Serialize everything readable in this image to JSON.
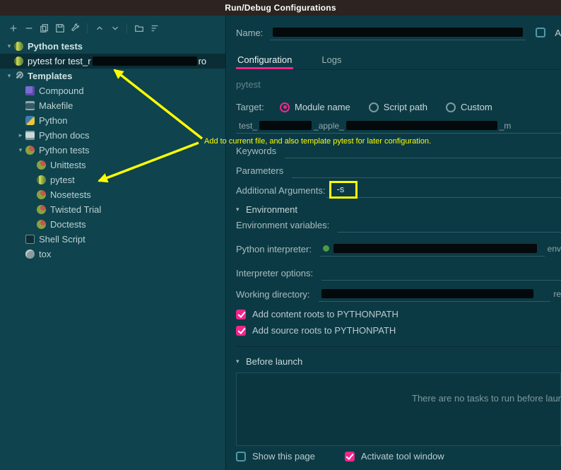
{
  "titlebar": {
    "title": "Run/Debug Configurations"
  },
  "icons": {
    "chevron_down": "▾",
    "chevron_right": "▸"
  },
  "toolbar": {
    "buttons": [
      "add",
      "remove",
      "copy",
      "save",
      "edit-templates",
      "move-up",
      "move-down",
      "new-folder",
      "sort"
    ]
  },
  "tree": {
    "items": [
      {
        "label": "Python tests"
      },
      {
        "label": "pytest for test_r",
        "suffix": "ro"
      },
      {
        "label": "Templates"
      },
      {
        "label": "Compound"
      },
      {
        "label": "Makefile"
      },
      {
        "label": "Python"
      },
      {
        "label": "Python docs"
      },
      {
        "label": "Python tests"
      },
      {
        "label": "Unittests"
      },
      {
        "label": "pytest"
      },
      {
        "label": "Nosetests"
      },
      {
        "label": "Twisted Trial"
      },
      {
        "label": "Doctests"
      },
      {
        "label": "Shell Script"
      },
      {
        "label": "tox"
      }
    ]
  },
  "form": {
    "name_label": "Name:",
    "allow_parallel_fragment": "A",
    "tabs": {
      "configuration": "Configuration",
      "logs": "Logs"
    },
    "group_label": "pytest",
    "target": {
      "label": "Target:",
      "options": {
        "module": "Module name",
        "script": "Script path",
        "custom": "Custom"
      },
      "selected": "Module name",
      "field_fragments": {
        "start": "test_",
        "mid": "_apple_",
        "end": "_m"
      }
    },
    "keywords_label": "Keywords",
    "parameters_label": "Parameters",
    "additional_arguments": {
      "label": "Additional Arguments:",
      "value": "-s"
    },
    "environment": {
      "section": "Environment",
      "env_vars_label": "Environment variables:",
      "interpreter_label": "Python interpreter:",
      "interpreter_edge_fragment": "env",
      "options_label": "Interpreter options:",
      "workdir_label": "Working directory:",
      "workdir_edge_fragment": "re",
      "add_content_roots": "Add content roots to PYTHONPATH",
      "add_source_roots": "Add source roots to PYTHONPATH"
    },
    "before_launch": {
      "section": "Before launch",
      "empty_text": "There are no tasks to run before launch"
    },
    "bottom": {
      "show_this": "Show this page",
      "activate": "Activate tool window"
    }
  },
  "annotation": {
    "text": "Add to current file, and also template pytest for later configuration."
  },
  "colors": {
    "accent_pink": "#f1258b",
    "annotation_yellow": "#fdfd00",
    "panel_bg": "#0c3a44",
    "sidebar_bg": "#0f434d",
    "titlebar_bg": "#2b2420"
  }
}
